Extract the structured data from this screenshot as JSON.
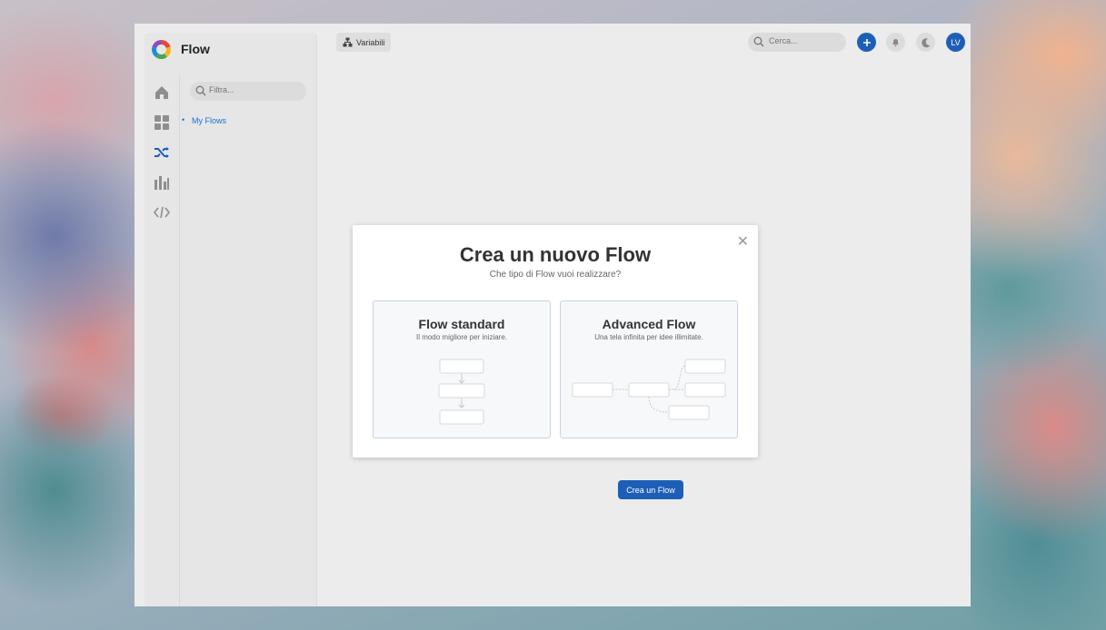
{
  "app": {
    "title": "Flow"
  },
  "sidebar": {
    "filter_placeholder": "Filtra...",
    "tree": [
      {
        "label": "My Flows"
      }
    ],
    "rail_icons": [
      "home-icon",
      "dashboard-icon",
      "flows-icon",
      "analytics-icon",
      "code-icon"
    ]
  },
  "topbar": {
    "variabili_label": "Variabili",
    "search_placeholder": "Cerca...",
    "avatar_initials": "LV"
  },
  "background": {
    "cta_label": "Crea un Flow"
  },
  "modal": {
    "title": "Crea un nuovo Flow",
    "subtitle": "Che tipo di Flow vuoi realizzare?",
    "close_symbol": "✕",
    "options": [
      {
        "title": "Flow standard",
        "subtitle": "Il modo migliore per iniziare."
      },
      {
        "title": "Advanced Flow",
        "subtitle": "Una tela infinita per idee illimitate."
      }
    ]
  },
  "colors": {
    "accent": "#1d5fb7",
    "link": "#1d6fd6"
  }
}
